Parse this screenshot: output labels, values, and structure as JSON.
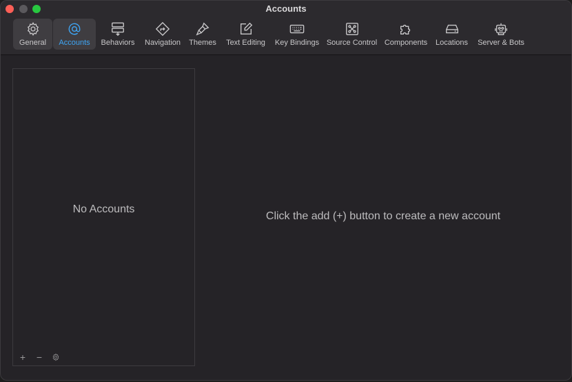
{
  "window": {
    "title": "Accounts"
  },
  "toolbar": {
    "items": [
      {
        "label": "General",
        "icon": "gear-icon"
      },
      {
        "label": "Accounts",
        "icon": "at-icon"
      },
      {
        "label": "Behaviors",
        "icon": "behaviors-icon"
      },
      {
        "label": "Navigation",
        "icon": "navigation-icon"
      },
      {
        "label": "Themes",
        "icon": "brush-icon"
      },
      {
        "label": "Text Editing",
        "icon": "pencil-square-icon"
      },
      {
        "label": "Key Bindings",
        "icon": "keyboard-icon"
      },
      {
        "label": "Source Control",
        "icon": "source-control-icon"
      },
      {
        "label": "Components",
        "icon": "puzzle-icon"
      },
      {
        "label": "Locations",
        "icon": "drive-icon"
      },
      {
        "label": "Server & Bots",
        "icon": "robot-icon"
      }
    ],
    "selected": "Accounts"
  },
  "accounts_list": {
    "empty_text": "No Accounts",
    "add_symbol": "+",
    "remove_symbol": "−"
  },
  "detail": {
    "hint": "Click the add (+) button to create a new account"
  },
  "colors": {
    "accent": "#3fa6f5",
    "background": "#252327",
    "toolbar": "#2c2a2e",
    "close": "#fe5f57",
    "maximize": "#28c840"
  }
}
